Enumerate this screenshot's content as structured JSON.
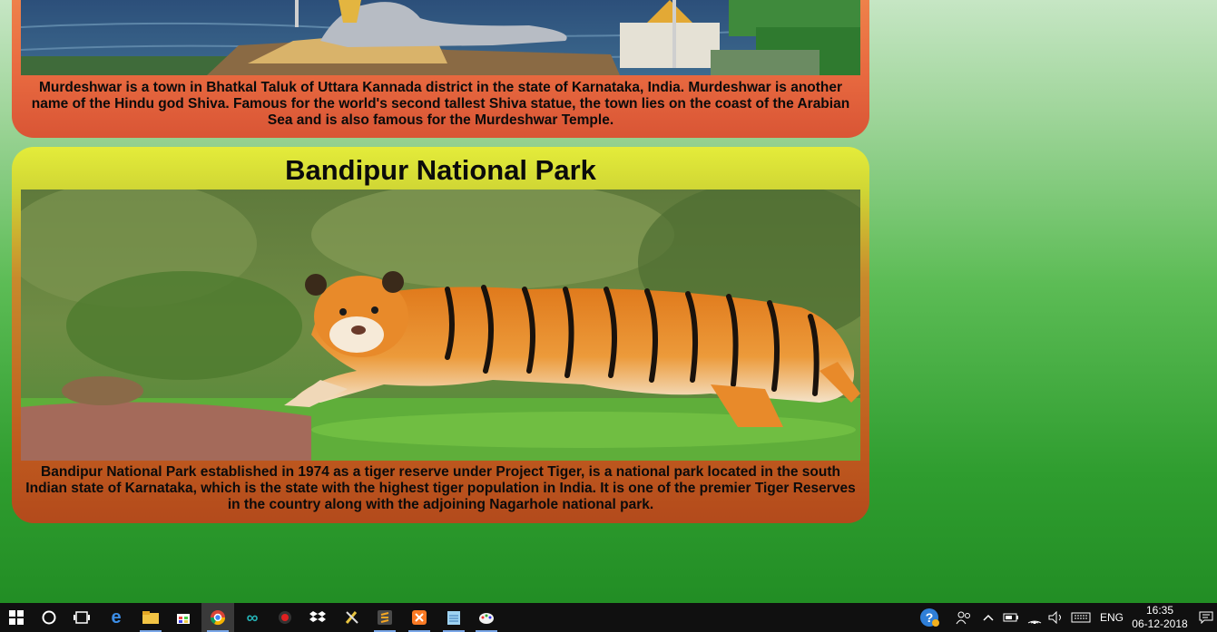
{
  "cards": [
    {
      "title": "",
      "description": "Murdeshwar is a town in Bhatkal Taluk of Uttara Kannada district in the state of Karnataka, India. Murdeshwar is another name of the Hindu god Shiva. Famous for the world's second tallest Shiva statue, the town lies on the coast of the Arabian Sea and is also famous for the Murdeshwar Temple."
    },
    {
      "title": "Bandipur National Park",
      "description": "Bandipur National Park established in 1974 as a tiger reserve under Project Tiger, is a national park located in the south Indian state of Karnataka, which is the state with the highest tiger population in India. It is one of the premier Tiger Reserves in the country along with the adjoining Nagarhole national park."
    }
  ],
  "taskbar": {
    "icons": [
      "windows-start-icon",
      "cortana-icon",
      "task-view-icon",
      "edge-icon",
      "file-explorer-icon",
      "store-icon",
      "chrome-icon",
      "arduino-icon",
      "record-icon",
      "dropbox-icon",
      "tools-icon",
      "sublime-icon",
      "xampp-icon",
      "notepad-icon",
      "paint-icon"
    ],
    "active_app": "chrome-icon",
    "language": "ENG",
    "time": "16:35",
    "date": "06-12-2018"
  }
}
